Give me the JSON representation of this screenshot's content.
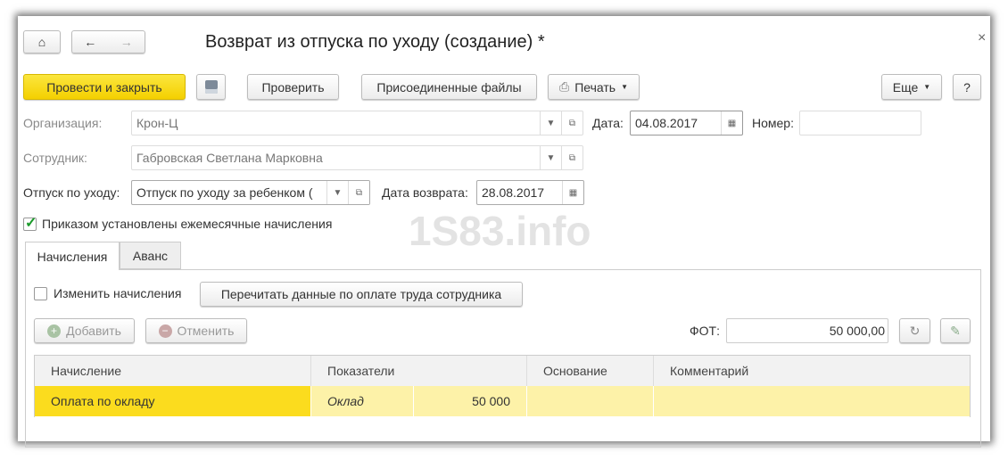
{
  "window": {
    "title": "Возврат из отпуска по уходу (создание) *",
    "close": "×"
  },
  "toolbar": {
    "post_close": "Провести и закрыть",
    "check": "Проверить",
    "files": "Присоединенные файлы",
    "print": "Печать",
    "more": "Еще",
    "help": "?"
  },
  "form": {
    "org_label": "Организация:",
    "org_value": "Крон-Ц",
    "date_label": "Дата:",
    "date_value": "04.08.2017",
    "number_label": "Номер:",
    "number_value": "",
    "employee_label": "Сотрудник:",
    "employee_value": "Габровская Светлана Марковна",
    "leave_label": "Отпуск по уходу:",
    "leave_value": "Отпуск по уходу за ребенком (",
    "return_label": "Дата возврата:",
    "return_value": "28.08.2017",
    "monthly_checkbox": "Приказом установлены ежемесячные начисления",
    "monthly_checked": true
  },
  "watermark": "1S83.info",
  "tabs": [
    {
      "label": "Начисления",
      "active": true
    },
    {
      "label": "Аванс",
      "active": false
    }
  ],
  "accruals": {
    "change_checkbox": "Изменить начисления",
    "change_checked": false,
    "reread_button": "Перечитать данные по оплате труда сотрудника",
    "add_button": "Добавить",
    "cancel_button": "Отменить",
    "fot_label": "ФОТ:",
    "fot_value": "50 000,00"
  },
  "table": {
    "columns": [
      "Начисление",
      "Показатели",
      "Основание",
      "Комментарий"
    ],
    "rows": [
      {
        "accrual": "Оплата по окладу",
        "indicator": "Оклад",
        "value": "50 000",
        "basis": "",
        "comment": ""
      }
    ]
  }
}
